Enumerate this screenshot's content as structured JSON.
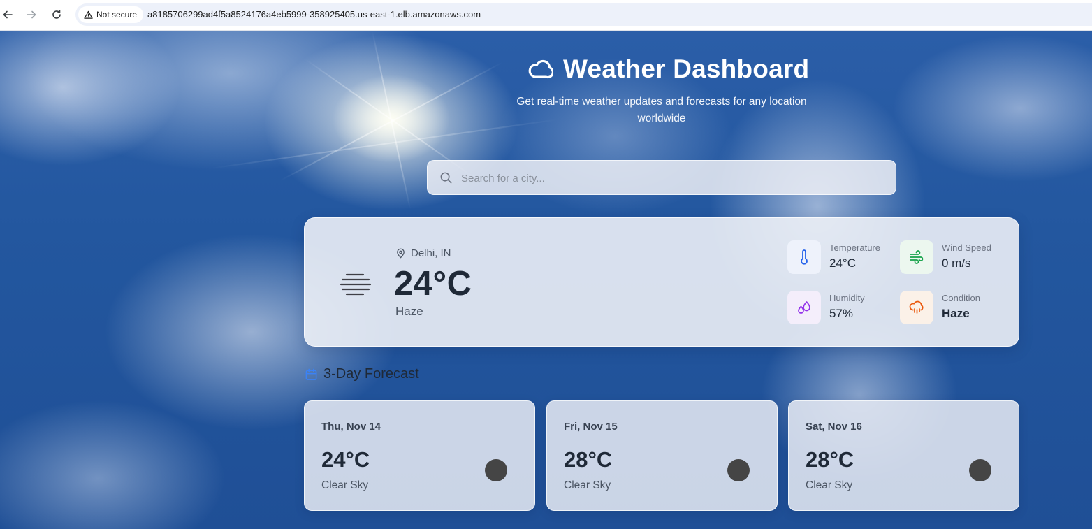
{
  "browser": {
    "security_label": "Not secure",
    "url": "a8185706299ad4f5a8524176a4eb5999-358925405.us-east-1.elb.amazonaws.com"
  },
  "header": {
    "title": "Weather Dashboard",
    "subtitle": "Get real-time weather updates and forecasts for any location worldwide"
  },
  "search": {
    "placeholder": "Search for a city...",
    "value": ""
  },
  "current": {
    "location": "Delhi, IN",
    "temperature": "24°C",
    "condition": "Haze",
    "metrics": {
      "temperature": {
        "label": "Temperature",
        "value": "24°C"
      },
      "wind": {
        "label": "Wind Speed",
        "value": "0 m/s"
      },
      "humidity": {
        "label": "Humidity",
        "value": "57%"
      },
      "condition": {
        "label": "Condition",
        "value": "Haze"
      }
    }
  },
  "forecast": {
    "heading": "3-Day Forecast",
    "days": [
      {
        "date": "Thu, Nov 14",
        "temp": "24°C",
        "condition": "Clear Sky"
      },
      {
        "date": "Fri, Nov 15",
        "temp": "28°C",
        "condition": "Clear Sky"
      },
      {
        "date": "Sat, Nov 16",
        "temp": "28°C",
        "condition": "Clear Sky"
      }
    ]
  },
  "colors": {
    "temperature_icon": "#2563eb",
    "wind_icon": "#16a34a",
    "humidity_icon": "#9333ea",
    "condition_icon": "#ea580c",
    "calendar_icon": "#3b82f6"
  }
}
